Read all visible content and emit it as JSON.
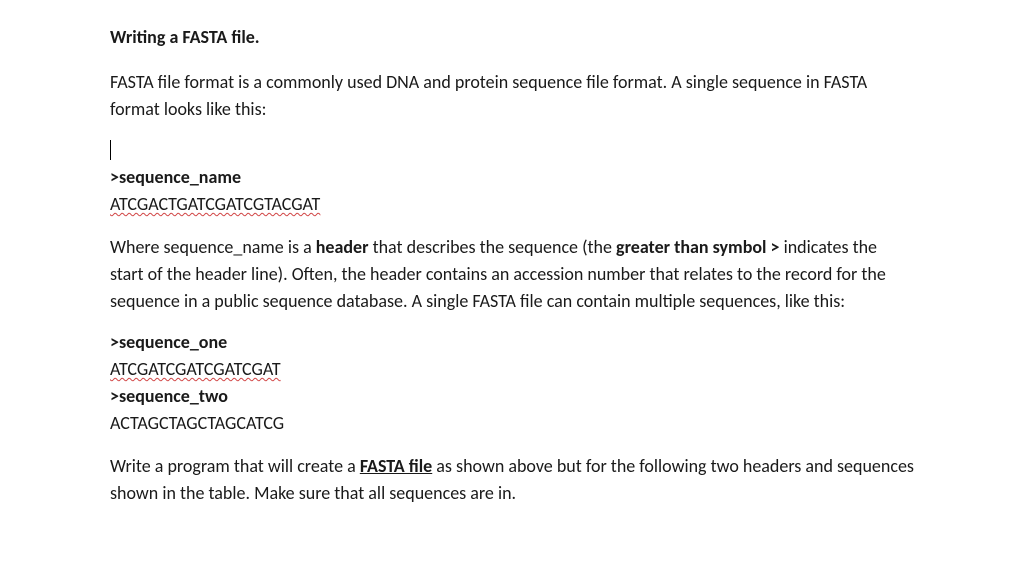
{
  "title": "Writing a FASTA file.",
  "intro": "FASTA file format is a commonly used DNA and protein sequence file format. A single sequence in FASTA format looks like this:",
  "example1": {
    "header": ">sequence_name",
    "sequence": "ATCGACTGATCGATCGTACGAT"
  },
  "explain_pre": "Where sequence_name is a ",
  "explain_header_word": "header",
  "explain_mid1": " that describes the sequence (the ",
  "explain_gt_phrase": "greater than symbol >",
  "explain_mid2": " indicates the start of the header line). Often, the header contains an accession number that relates to the record for the sequence in a public sequence database. A single FASTA file can contain multiple sequences, like this:",
  "example2": {
    "header1": ">sequence_one",
    "sequence1": "ATCGATCGATCGATCGAT",
    "header2": ">sequence_two",
    "sequence2": "ACTAGCTAGCTAGCATCG"
  },
  "task_pre": "Write a program that will create a ",
  "task_fasta": "FASTA file",
  "task_post": " as shown above but for the following two headers and sequences shown in the table. Make sure that all sequences are in."
}
